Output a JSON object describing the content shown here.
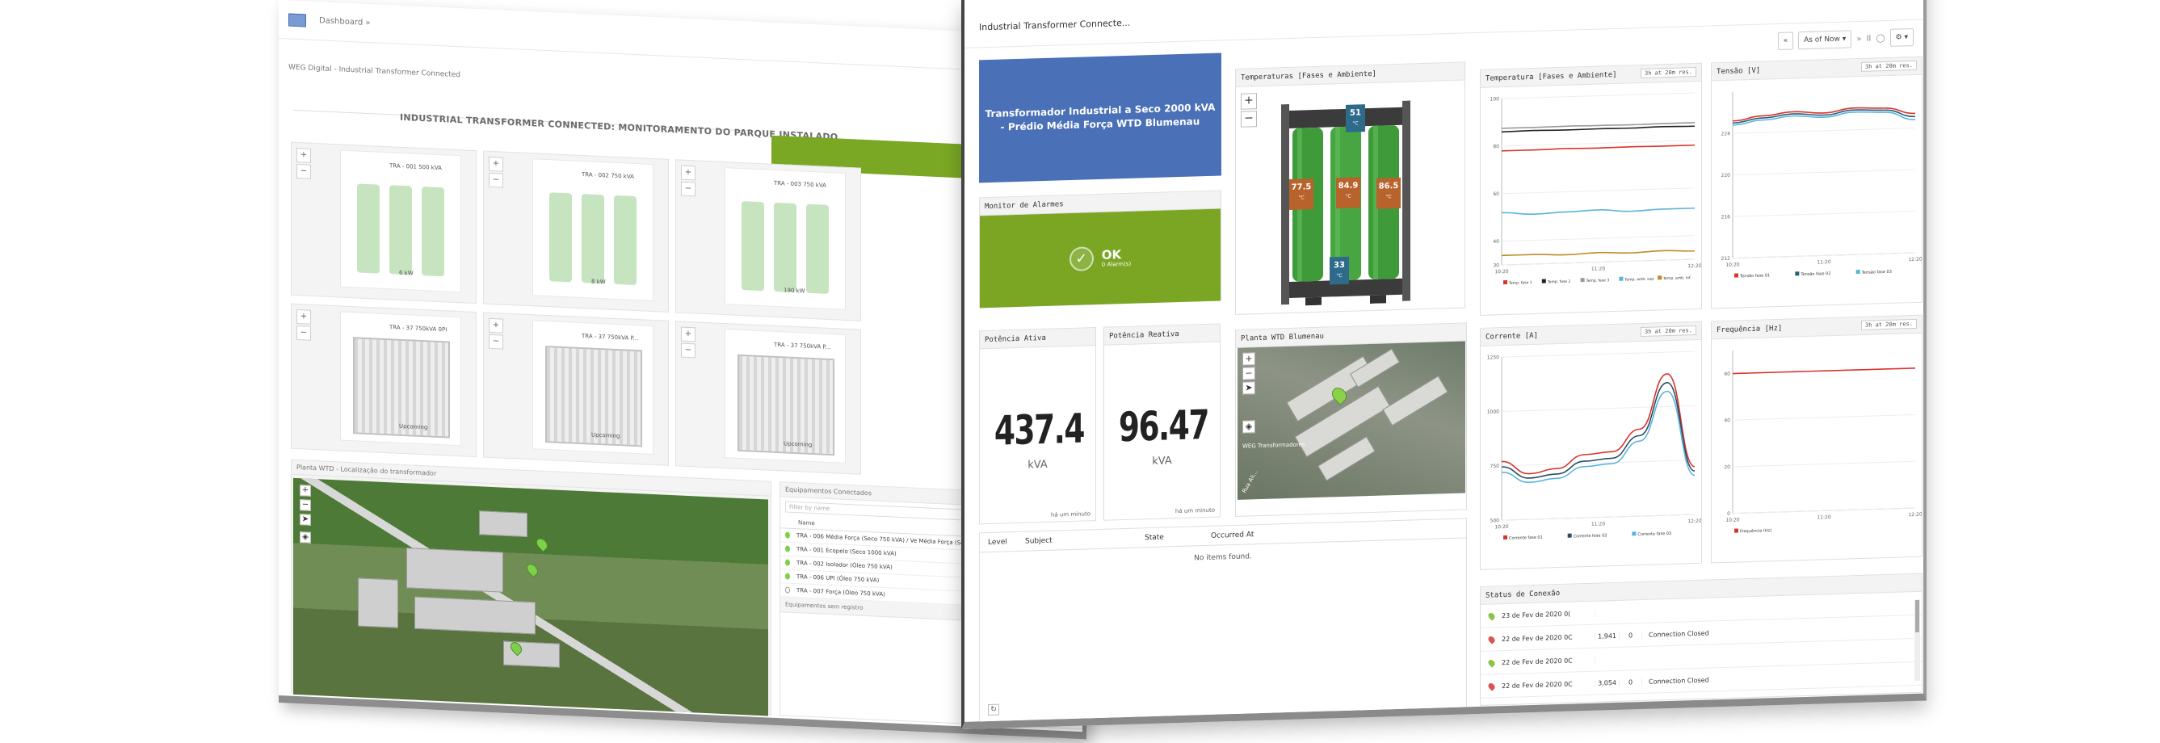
{
  "back": {
    "crumb": "Dashboard »",
    "subtitle": "WEG Digital - Industrial Transformer Connected",
    "headline": "INDUSTRIAL TRANSFORMER CONNECTED: MONITORAMENTO DO PARQUE INSTALADO",
    "cards": [
      {
        "title": "TRA - 001 500 kVA",
        "label": "6 kW"
      },
      {
        "title": "TRA - 002 750 kVA",
        "label": "8 kW"
      },
      {
        "title": "TRA - 003 750 kVA",
        "label": "190 kW"
      },
      {
        "title": "TRA - 37 750kVA 0PI",
        "label": "Upcoming"
      },
      {
        "title": "TRA - 37 750kVA P...",
        "label": "Upcoming"
      },
      {
        "title": "TRA - 37 750kVA P...",
        "label": "Upcoming"
      }
    ],
    "map_title": "Planta WTD - Localização do transformador",
    "list_title": "Equipamentos Conectados",
    "filter_placeholder": "Filter by name",
    "list_header": "Name",
    "list_rows": [
      "TRA - 006 Média Força (Seco 750 kVA) / Ve Média Força (Seco 2000 kVA)",
      "TRA - 001 Ecopelo (Seco 1000 kVA)",
      "TRA - 002 Isolador (Óleo 750 kVA)",
      "TRA - 006 UPI (Óleo 750 kVA)",
      "TRA - 007 Força (Óleo 750 kVA)"
    ],
    "list_footer": "Equipamentos sem registro"
  },
  "front": {
    "title": "Industrial Transformer Connecte...",
    "toolbar": {
      "prev": "«",
      "range": "As of Now ▾",
      "next": "»",
      "pause": "II",
      "refresh": "◯",
      "settings": "⚙ ▾"
    },
    "banner": "Transformador Industrial a Seco 2000 kVA - Prédio Média Força WTD Blumenau",
    "alarm": {
      "title": "Monitor de Alarmes",
      "status": "OK",
      "sub": "0 Alarm(s)"
    },
    "temp3d": {
      "title": "Temperaturas [Fases e Ambiente]",
      "phase_a": "77.5",
      "phase_b": "84.9",
      "phase_c": "86.5",
      "amb_top": "51",
      "amb_bottom": "33",
      "unit": "°C"
    },
    "active_power": {
      "title": "Potência Ativa",
      "value": "437.4",
      "unit": "kVA",
      "ago": "há um minuto"
    },
    "reactive_power": {
      "title": "Potência Reativa",
      "value": "96.47",
      "unit": "kVA",
      "ago": "há um minuto"
    },
    "plant_map": {
      "title": "Planta WTD Blumenau",
      "label": "WEG Transformadores",
      "street": "Rua Ali..."
    },
    "alarm_table": {
      "cols": [
        "Level",
        "Subject",
        "State",
        "Occurred At"
      ],
      "empty": "No items found."
    },
    "status": {
      "title": "Status de Conexão",
      "rows": [
        {
          "kind": "ok",
          "date": "23 de Fev de 2020 0(",
          "n1": "",
          "n2": "",
          "msg": ""
        },
        {
          "kind": "err",
          "date": "22 de Fev de 2020 0C",
          "n1": "1,941",
          "n2": "0",
          "msg": "Connection Closed"
        },
        {
          "kind": "ok",
          "date": "22 de Fev de 2020 0C",
          "n1": "",
          "n2": "",
          "msg": ""
        },
        {
          "kind": "err",
          "date": "22 de Fev de 2020 0C",
          "n1": "3,054",
          "n2": "0",
          "msg": "Connection Closed"
        }
      ]
    },
    "range_tag": "3h at 20m res."
  },
  "chart_data": [
    {
      "type": "line",
      "title": "Temperatura [Fases e Ambiente]",
      "x": [
        "10:20",
        "11:20",
        "12:20"
      ],
      "ylim": [
        30,
        100
      ],
      "yticks": [
        30,
        40,
        60,
        80,
        100
      ],
      "series": [
        {
          "name": "Temp. fase 1",
          "color": "#d9342b",
          "values": [
            78,
            78,
            78.2,
            78,
            78.1,
            78,
            78
          ]
        },
        {
          "name": "Temp. fase 2",
          "color": "#222222",
          "values": [
            86,
            86.2,
            86,
            86.1,
            86,
            86.2,
            86
          ]
        },
        {
          "name": "Temp. fase 3",
          "color": "#9a9a9a",
          "values": [
            87.5,
            87.5,
            87.6,
            87.5,
            87.4,
            87.5,
            87.5
          ]
        },
        {
          "name": "Temp. amb. sup.",
          "color": "#5ab4dd",
          "values": [
            52,
            51,
            51.5,
            52,
            51,
            51.5,
            51.5
          ]
        },
        {
          "name": "Temp. amb. inf.",
          "color": "#c08a2a",
          "values": [
            34,
            34,
            33.5,
            34,
            33.5,
            34,
            33.5
          ]
        }
      ]
    },
    {
      "type": "line",
      "title": "Tensão [V]",
      "x": [
        "10:20",
        "11:20",
        "12:20"
      ],
      "ylim": [
        212,
        228
      ],
      "yticks": [
        212,
        216,
        220,
        224
      ],
      "series": [
        {
          "name": "Tensão fase 01",
          "color": "#d9342b",
          "values": [
            225.2,
            225.6,
            225.9,
            225.7,
            226.1,
            226.0,
            225.4
          ]
        },
        {
          "name": "Tensão fase 02",
          "color": "#2b5e7a",
          "values": [
            225.0,
            225.4,
            225.7,
            225.5,
            225.9,
            225.8,
            225.1
          ]
        },
        {
          "name": "Tensão fase 03",
          "color": "#5ab4dd",
          "values": [
            224.8,
            225.2,
            225.5,
            225.3,
            225.7,
            225.6,
            224.8
          ]
        }
      ]
    },
    {
      "type": "line",
      "title": "Corrente [A]",
      "x": [
        "10:20",
        "11:20",
        "12:20"
      ],
      "ylim": [
        500,
        1250
      ],
      "yticks": [
        500,
        750,
        1000,
        1250
      ],
      "series": [
        {
          "name": "Corrente fase 01",
          "color": "#d9342b",
          "values": [
            770,
            710,
            730,
            790,
            800,
            900,
            1150,
            720
          ]
        },
        {
          "name": "Corrente fase 02",
          "color": "#2b4d63",
          "values": [
            745,
            690,
            705,
            760,
            770,
            870,
            1110,
            700
          ]
        },
        {
          "name": "Corrente fase 03",
          "color": "#5ab4dd",
          "values": [
            720,
            670,
            685,
            735,
            745,
            845,
            1070,
            680
          ]
        }
      ]
    },
    {
      "type": "line",
      "title": "Frequência [Hz]",
      "x": [
        "10:20",
        "11:20",
        "12:20"
      ],
      "ylim": [
        0,
        70
      ],
      "yticks": [
        0,
        20,
        40,
        60
      ],
      "series": [
        {
          "name": "Frequência (Hz)",
          "color": "#d9342b",
          "values": [
            60,
            60,
            60,
            60,
            60,
            60,
            60
          ]
        }
      ]
    }
  ]
}
